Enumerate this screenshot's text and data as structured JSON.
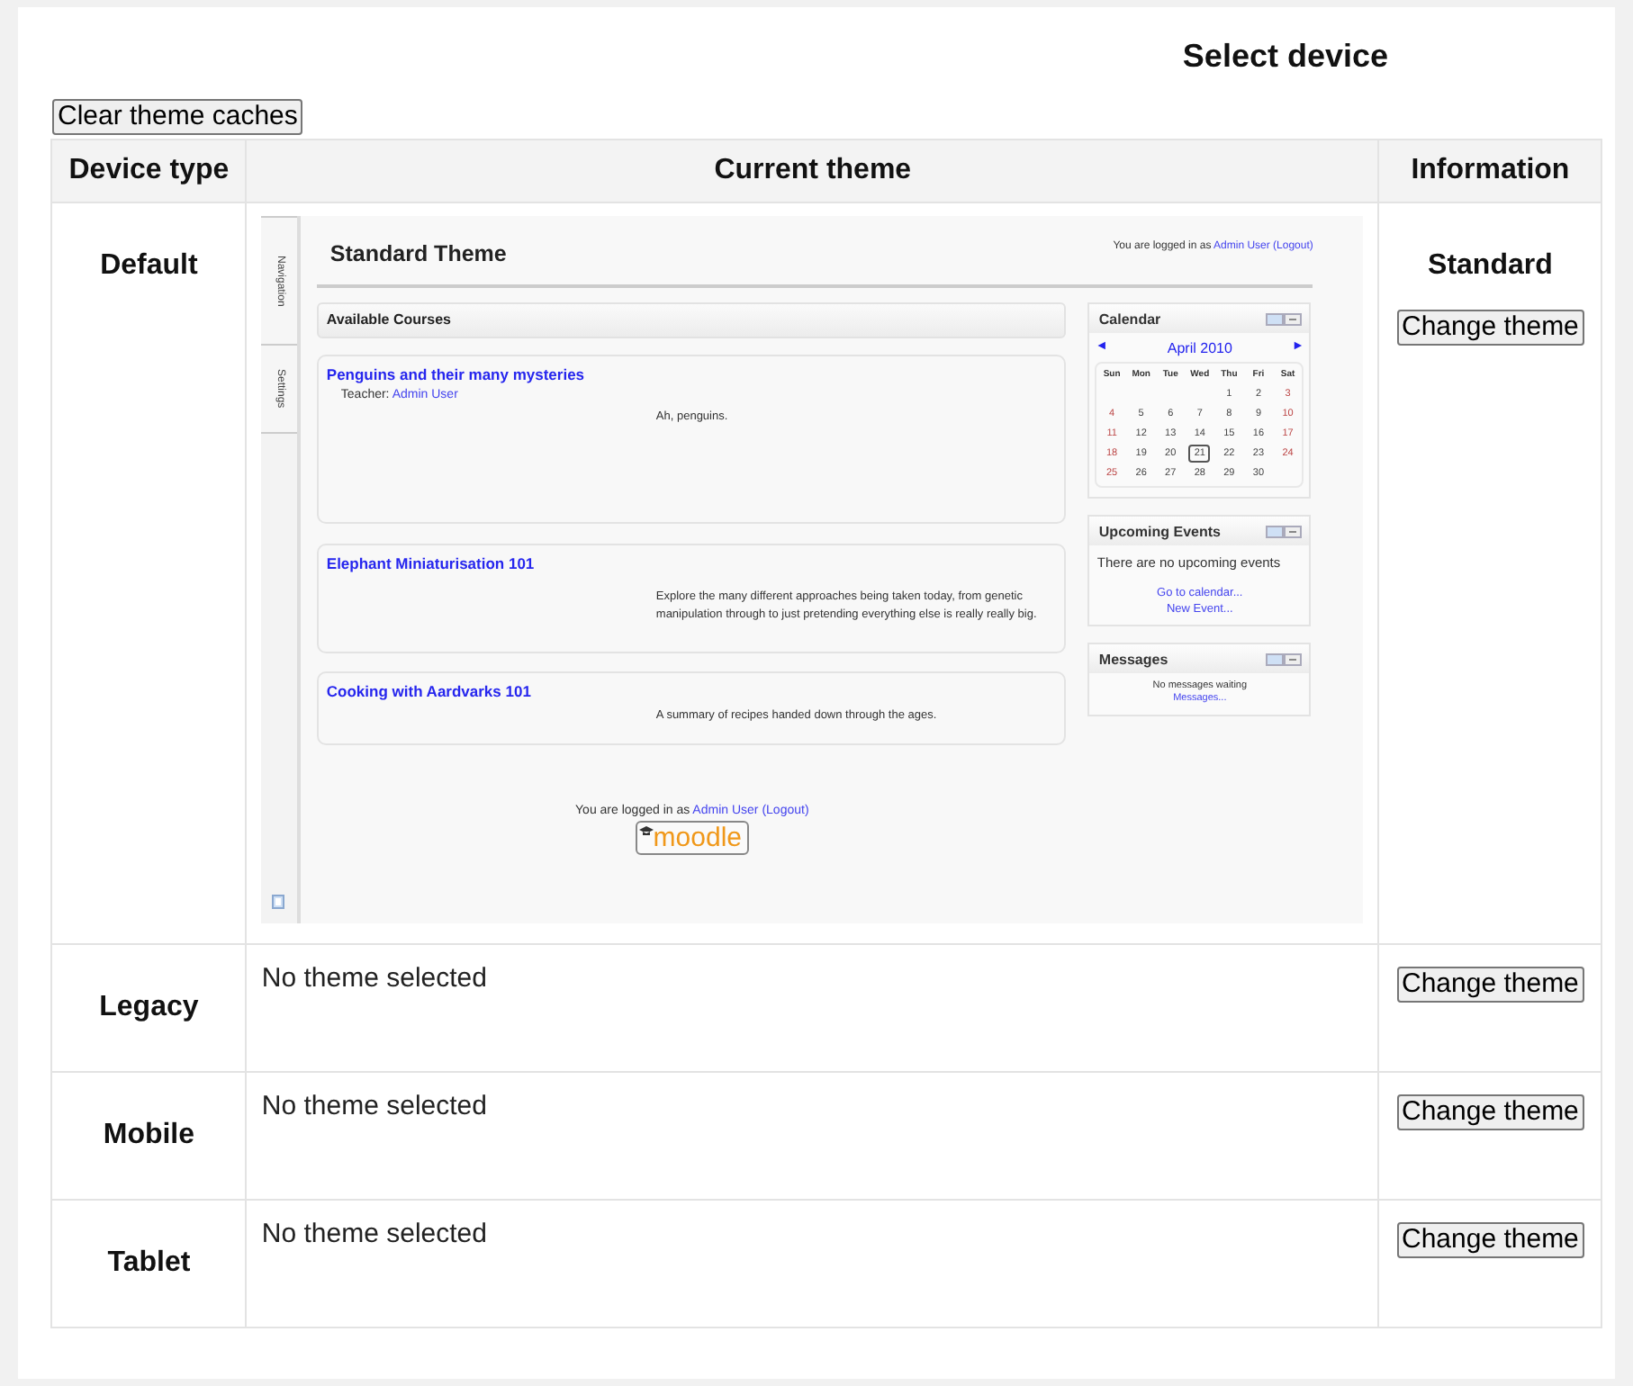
{
  "page_title": "Select device",
  "clear_button": "Clear theme caches",
  "columns": [
    "Device type",
    "Current theme",
    "Information"
  ],
  "rows": [
    {
      "device": "Default",
      "kind": "preview",
      "theme_name": "Standard",
      "button": "Change theme"
    },
    {
      "device": "Legacy",
      "kind": "empty",
      "message": "No theme selected",
      "button": "Change theme"
    },
    {
      "device": "Mobile",
      "kind": "empty",
      "message": "No theme selected",
      "button": "Change theme"
    },
    {
      "device": "Tablet",
      "kind": "empty",
      "message": "No theme selected",
      "button": "Change theme"
    }
  ],
  "preview": {
    "side_tabs": [
      "Navigation",
      "Settings"
    ],
    "title": "Standard Theme",
    "login": {
      "prefix": "You are logged in as",
      "user": "Admin User",
      "logout": "(Logout)"
    },
    "courses_heading": "Available Courses",
    "courses": [
      {
        "title": "Penguins and their many mysteries",
        "teacher_label": "Teacher:",
        "teacher": "Admin User",
        "summary": "Ah, penguins."
      },
      {
        "title": "Elephant Miniaturisation 101",
        "summary": "Explore the many different approaches being taken today, from genetic manipulation through to just pretending everything else is really really big."
      },
      {
        "title": "Cooking with Aardvarks 101",
        "summary": "A summary of recipes handed down through the ages."
      }
    ],
    "calendar": {
      "title": "Calendar",
      "prev": "◄",
      "month": "April 2010",
      "next": "►",
      "weekdays": [
        "Sun",
        "Mon",
        "Tue",
        "Wed",
        "Thu",
        "Fri",
        "Sat"
      ],
      "weeks": [
        [
          {
            "day": "1",
            "selected": false
          },
          {
            "day": "2",
            "selected": false
          },
          {
            "day": "3",
            "selected": false
          }
        ],
        [
          {
            "day": "4",
            "selected": false
          },
          {
            "day": "5",
            "selected": false
          },
          {
            "day": "6",
            "selected": false
          },
          {
            "day": "7",
            "selected": false
          },
          {
            "day": "8",
            "selected": false
          },
          {
            "day": "9",
            "selected": false
          },
          {
            "day": "10",
            "selected": false
          }
        ],
        [
          {
            "day": "11",
            "selected": false
          },
          {
            "day": "12",
            "selected": false
          },
          {
            "day": "13",
            "selected": false
          },
          {
            "day": "14",
            "selected": false
          },
          {
            "day": "15",
            "selected": false
          },
          {
            "day": "16",
            "selected": false
          },
          {
            "day": "17",
            "selected": false
          }
        ],
        [
          {
            "day": "18",
            "selected": false
          },
          {
            "day": "19",
            "selected": false
          },
          {
            "day": "20",
            "selected": false
          },
          {
            "day": "21",
            "selected": true
          },
          {
            "day": "22",
            "selected": false
          },
          {
            "day": "23",
            "selected": false
          },
          {
            "day": "24",
            "selected": false
          }
        ],
        [
          {
            "day": "25",
            "selected": false
          },
          {
            "day": "26",
            "selected": false
          },
          {
            "day": "27",
            "selected": false
          },
          {
            "day": "28",
            "selected": false
          },
          {
            "day": "29",
            "selected": false
          },
          {
            "day": "30",
            "selected": false
          }
        ]
      ]
    },
    "upcoming": {
      "title": "Upcoming Events",
      "text": "There are no upcoming events",
      "links": [
        "Go to calendar...",
        "New Event..."
      ]
    },
    "messages": {
      "title": "Messages",
      "text": "No messages waiting",
      "link": "Messages..."
    },
    "footer_login": {
      "prefix": "You are logged in as",
      "user": "Admin User",
      "logout": "(Logout)"
    },
    "logo": "moodle"
  }
}
